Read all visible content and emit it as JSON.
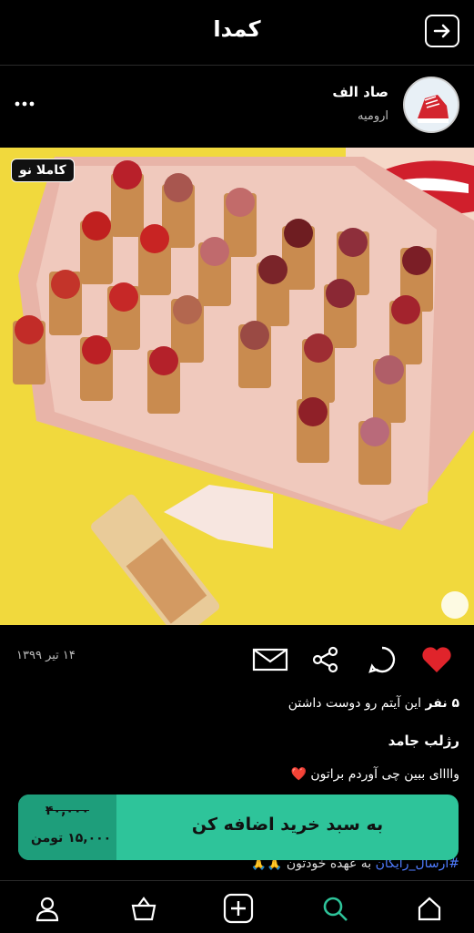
{
  "header": {
    "title": "کمدا"
  },
  "seller": {
    "name": "صاد الف",
    "city": "ارومیه"
  },
  "post": {
    "badge": "کاملا نو",
    "date": "۱۴ تیر ۱۳۹۹",
    "likes_count": "۵ نفر",
    "likes_text": "این آیتم رو دوست داشتن",
    "title": "رژلب جامد",
    "desc_line1": "واااای ببین چی آوردم براتون ❤️",
    "hashtag": "#ارسال_رایگان",
    "desc_line2": "به عهده خودتون 🙏🙏"
  },
  "cart": {
    "old_price": "۴۰,۰۰۰",
    "new_price": "۱۵,۰۰۰ تومن",
    "label": "به سبد خرید اضافه کن"
  },
  "colors": {
    "accent": "#2ec49a",
    "heart": "#e0242b"
  },
  "icons": [
    "back-icon",
    "more-icon",
    "heart-icon",
    "comment-icon",
    "share-icon",
    "mail-icon",
    "profile-icon",
    "basket-icon",
    "add-icon",
    "search-icon",
    "home-icon"
  ]
}
